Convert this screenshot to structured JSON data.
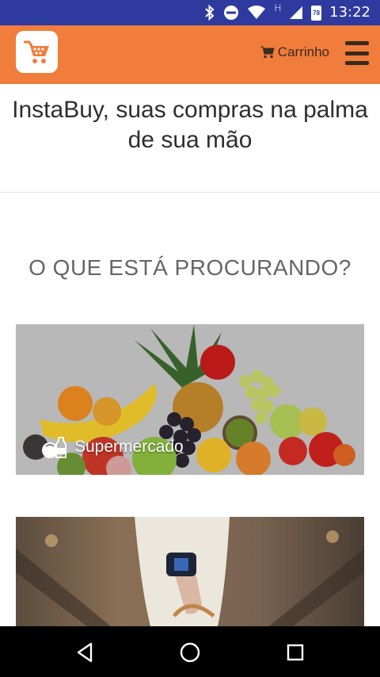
{
  "status_bar": {
    "time": "13:22",
    "icons": [
      "bluetooth-icon",
      "do-not-disturb-icon",
      "wifi-icon",
      "signal-h-icon",
      "battery-icon"
    ],
    "network_label": "H",
    "battery_label": "78"
  },
  "header": {
    "logo_icon": "shopping-basket-icon",
    "cart_label": "Carrinho",
    "cart_icon": "cart-icon",
    "menu_icon": "hamburger-menu-icon",
    "background_color": "#f07d3b"
  },
  "tagline": "InstaBuy, suas compras na palma de sua mão",
  "section_title": "O QUE ESTÁ PROCURANDO?",
  "categories": [
    {
      "label": "Supermercado",
      "icon": "grocery-icon"
    },
    {
      "label": "",
      "icon": ""
    }
  ],
  "nav_bar": {
    "back_icon": "back-triangle-icon",
    "home_icon": "home-circle-icon",
    "recents_icon": "recents-square-icon"
  }
}
